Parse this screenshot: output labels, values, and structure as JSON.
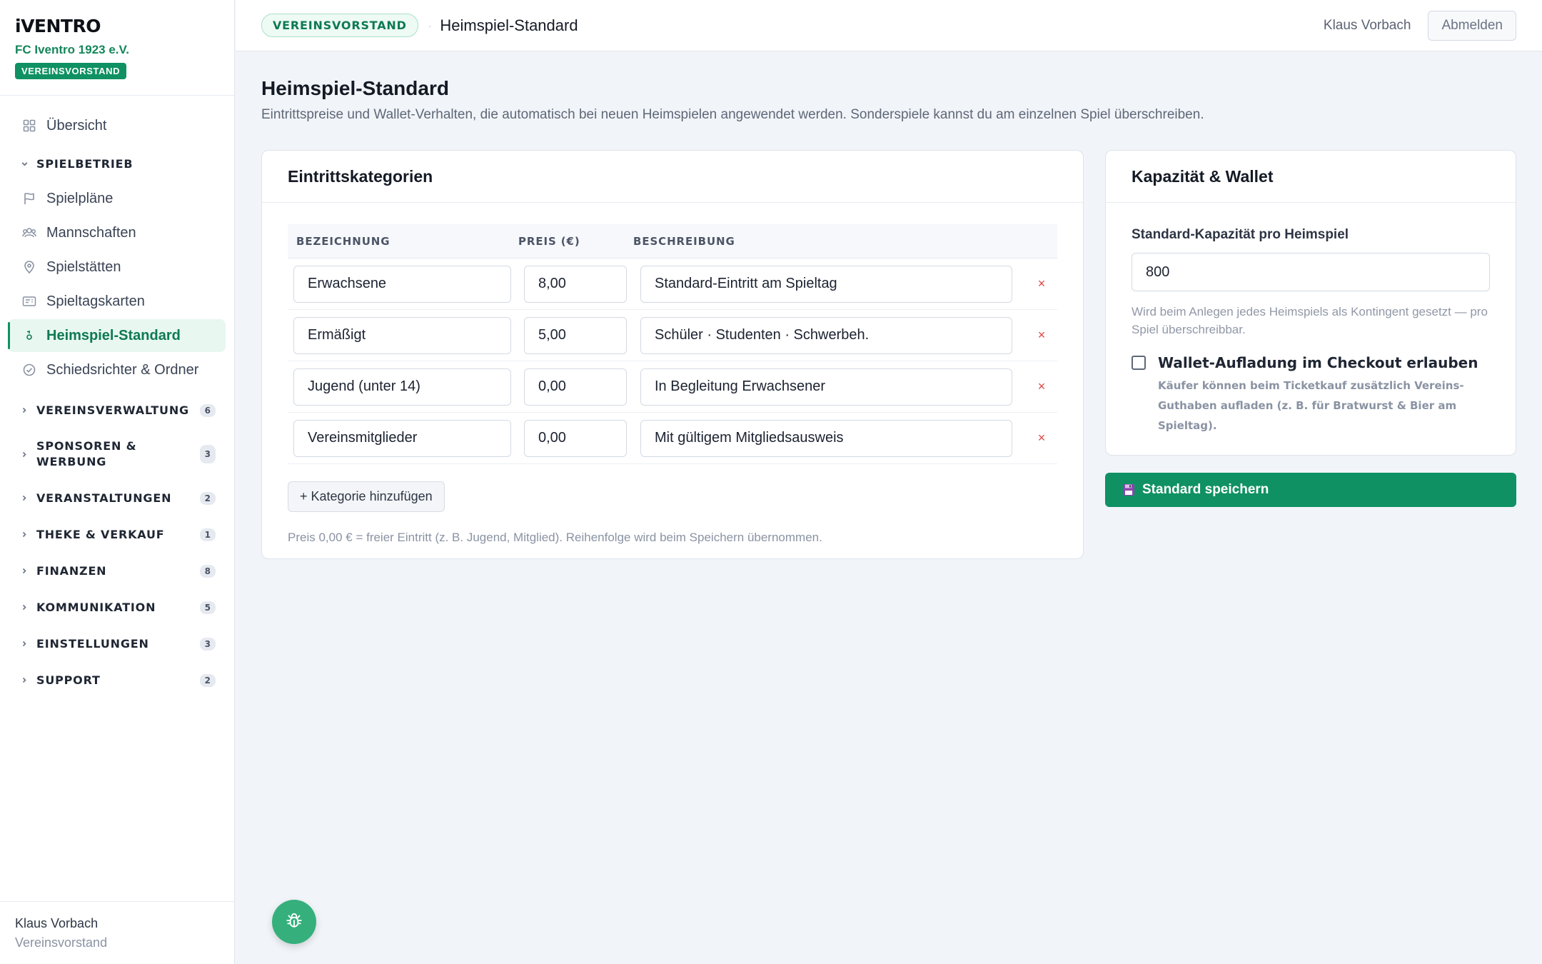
{
  "brand": {
    "logo": "iVENTRO",
    "club": "FC Iventro 1923 e.V.",
    "role": "VEREINSVORSTAND"
  },
  "nav": {
    "overview": "Übersicht",
    "section_open": "SPIELBETRIEB",
    "items": [
      {
        "label": "Spielpläne",
        "icon": "flag-icon"
      },
      {
        "label": "Mannschaften",
        "icon": "team-icon"
      },
      {
        "label": "Spielstätten",
        "icon": "map-pin-icon"
      },
      {
        "label": "Spieltagskarten",
        "icon": "ticket-icon"
      },
      {
        "label": "Heimspiel-Standard",
        "icon": "default-icon",
        "active": true
      },
      {
        "label": "Schiedsrichter & Ordner",
        "icon": "check-circle-icon"
      }
    ],
    "sections": [
      {
        "label": "VEREINSVERWALTUNG",
        "count": "6"
      },
      {
        "label": "SPONSOREN & WERBUNG",
        "count": "3"
      },
      {
        "label": "VERANSTALTUNGEN",
        "count": "2"
      },
      {
        "label": "THEKE & VERKAUF",
        "count": "1"
      },
      {
        "label": "FINANZEN",
        "count": "8"
      },
      {
        "label": "KOMMUNIKATION",
        "count": "5"
      },
      {
        "label": "EINSTELLUNGEN",
        "count": "3"
      },
      {
        "label": "SUPPORT",
        "count": "2"
      }
    ]
  },
  "footer": {
    "user": "Klaus Vorbach",
    "role": "Vereinsvorstand"
  },
  "topbar": {
    "badge": "VEREINSVORSTAND",
    "sep": "·",
    "title": "Heimspiel-Standard",
    "user": "Klaus Vorbach",
    "logout": "Abmelden"
  },
  "page": {
    "title": "Heimspiel-Standard",
    "description": "Eintrittspreise und Wallet-Verhalten, die automatisch bei neuen Heimspielen angewendet werden. Sonderspiele kannst du am einzelnen Spiel überschreiben."
  },
  "categories": {
    "title": "Eintrittskategorien",
    "headers": {
      "name": "BEZEICHNUNG",
      "price": "PREIS (€)",
      "description": "BESCHREIBUNG"
    },
    "rows": [
      {
        "name": "Erwachsene",
        "price": "8,00",
        "description": "Standard-Eintritt am Spieltag"
      },
      {
        "name": "Ermäßigt",
        "price": "5,00",
        "description": "Schüler · Studenten · Schwerbeh."
      },
      {
        "name": "Jugend (unter 14)",
        "price": "0,00",
        "description": "In Begleitung Erwachsener"
      },
      {
        "name": "Vereinsmitglieder",
        "price": "0,00",
        "description": "Mit gültigem Mitgliedsausweis"
      }
    ],
    "delete_symbol": "×",
    "add_label": "+ Kategorie hinzufügen",
    "hint": "Preis 0,00 € = freier Eintritt (z. B. Jugend, Mitglied). Reihenfolge wird beim Speichern übernommen."
  },
  "capacity": {
    "title": "Kapazität & Wallet",
    "label": "Standard-Kapazität pro Heimspiel",
    "value": "800",
    "help": "Wird beim Anlegen jedes Heimspiels als Kontingent gesetzt — pro Spiel überschreibbar.",
    "wallet_label": "Wallet-Aufladung im Checkout erlauben",
    "wallet_desc": "Käufer können beim Ticketkauf zusätzlich Vereins-Guthaben aufladen (z. B. für Bratwurst & Bier am Spieltag).",
    "wallet_checked": false
  },
  "save": {
    "label": "Standard speichern",
    "icon": "floppy-disk-icon"
  },
  "fab": {
    "icon": "bug-icon"
  },
  "colors": {
    "accent": "#0f9163",
    "accent_light": "#e8f7f0",
    "danger": "#e04646"
  }
}
